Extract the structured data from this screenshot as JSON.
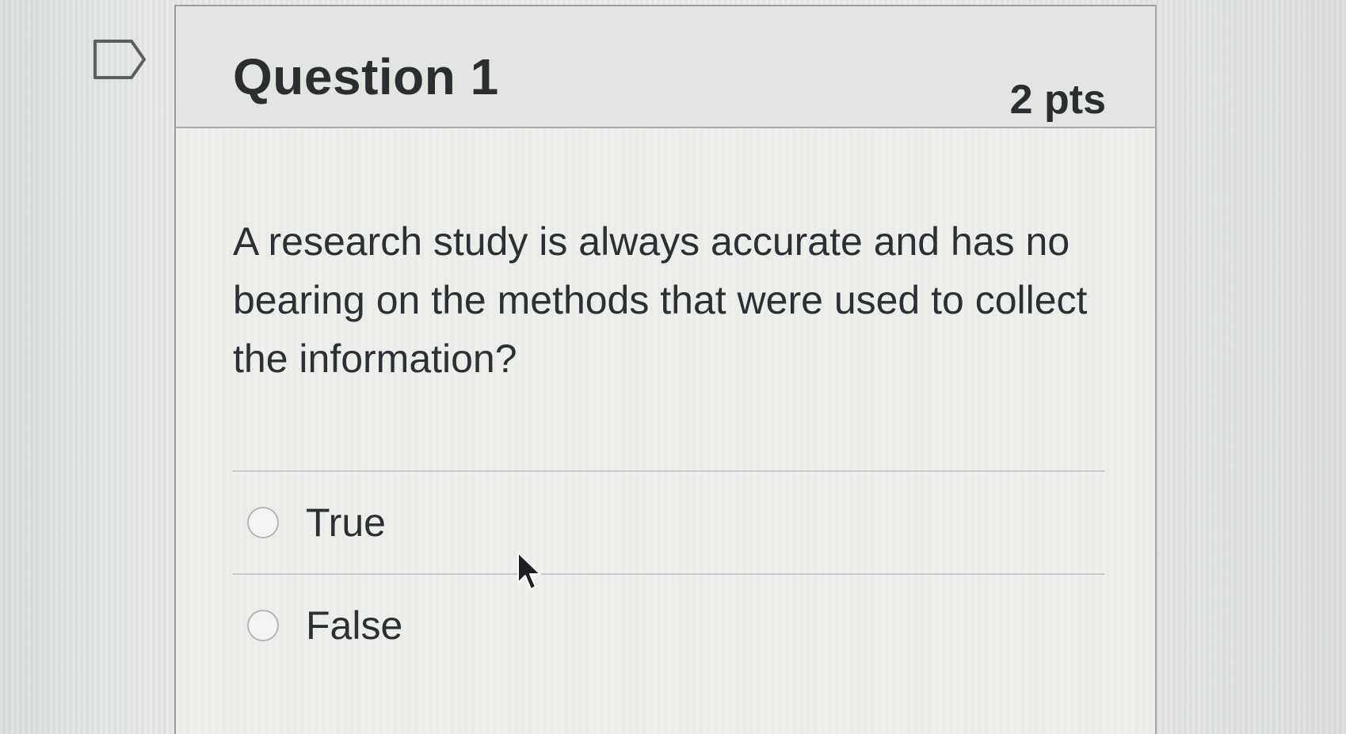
{
  "bookmark": {
    "icon": "bookmark-flag-icon"
  },
  "question": {
    "title": "Question 1",
    "points": "2 pts",
    "text": "A research study is always accurate and has no bearing on the methods that were used to collect the information?"
  },
  "answers": [
    {
      "label": "True",
      "selected": false
    },
    {
      "label": "False",
      "selected": false
    }
  ],
  "cursor": {
    "icon": "mouse-pointer-icon"
  }
}
